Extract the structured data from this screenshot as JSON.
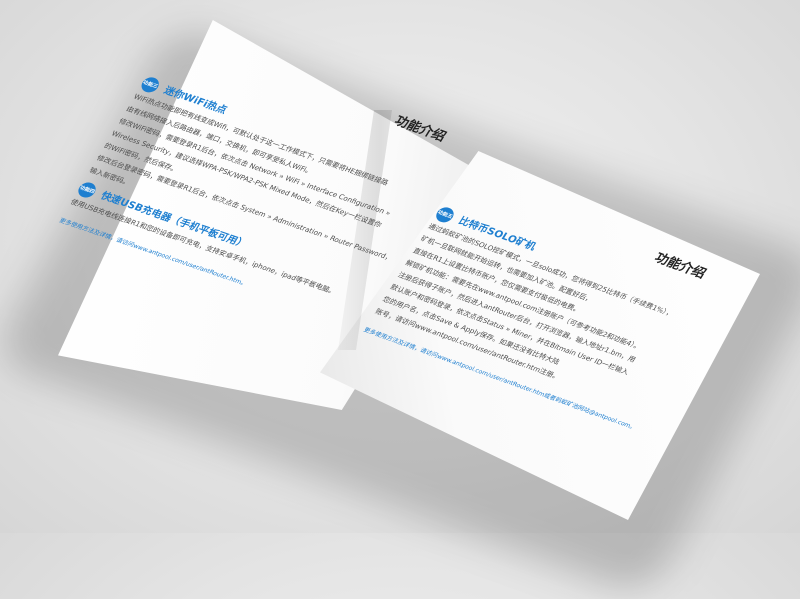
{
  "left_page": {
    "section_title": "功能介绍",
    "feature1": {
      "badge": "功能三",
      "heading": "迷你WiFi热点",
      "lines": [
        "WiFi热点功能即把有线变成Wifi，可默认处于这一工作模式下，只需要将HE捆绑链接路",
        "由有线网络接入后路由器，端口，交换机，即可享受私人WiFi。",
        "修改WiFi密码，需要登录R1后台，依次点击 Network » WiFi » Interface Configuration »",
        "Wireless Security，建议选择WPA-PSK/WPA2-PSK Mixed Mode，然后在Key一栏设置你",
        "的WiFi密码，然后保存。",
        "修改后台登录密码，需要登录R1后台，依次点击 System » Administration » Router Password，",
        "输入新密码。"
      ]
    },
    "feature2": {
      "badge": "功能四",
      "heading": "快速USB充电器（手机平板可用）",
      "lines": [
        "使用USB充电线连接R1和您的设备即可充电，支持安卓手机，iphone，ipad等平板电脑。"
      ]
    },
    "footer": "更多使用方法及详情，请访问www.antpool.com/user/antRouter.htm。"
  },
  "right_page": {
    "section_title": "功能介绍",
    "feature": {
      "badge": "功能五",
      "heading": "比特币SOLO矿机",
      "lines": [
        "通过蚂蚁矿池的SOLO挖矿模式，一旦solo成功，您将得到25比特币（手续费1%），",
        "矿机一旦联网就能开始运转，也需要加入矿池。配置好后，",
        "直接在R1上设置比特币账户，您仅需要支付极低的电费。",
        "解锁矿机功能：需要先在www.antpool.com注册账户（可参考功能2和功能4）。",
        "注册后获得子账户，然后进入antRouter后台，打开浏览器，输入地址r1.bm，用",
        "默认账户和密码登录，依次点击Status » Miner，并在Bitmain User ID一栏输入",
        "您的用户名，点击Save & Apply保存。如果还没有比特大陆",
        "账号，请访问www.antpool.com/user/antRouter.htm注册。"
      ]
    },
    "footer": "更多使用方法及详情，请访问www.antpool.com/user/antRouter.htm或者蚂蚁矿池网站@antpool.com。"
  }
}
